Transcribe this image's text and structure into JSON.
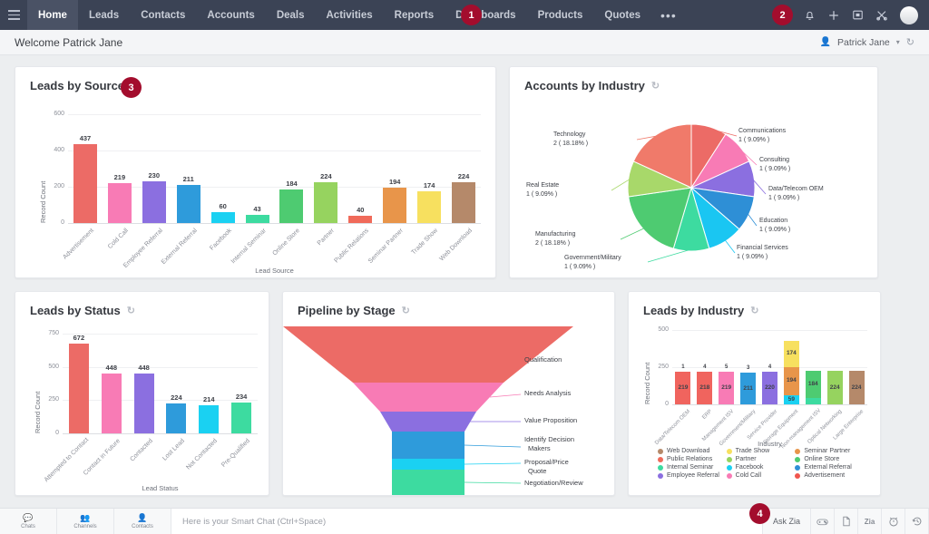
{
  "nav": {
    "menu_icon": "hamburger-icon",
    "tabs": [
      "Home",
      "Leads",
      "Contacts",
      "Accounts",
      "Deals",
      "Activities",
      "Reports",
      "Dashboards",
      "Products",
      "Quotes"
    ],
    "active_tab": "Home",
    "more_label": "•••",
    "badge_1": "1",
    "badge_2": "2",
    "icons": [
      "search-icon",
      "bell-icon",
      "plus-icon",
      "screen-icon",
      "tools-icon",
      "avatar"
    ]
  },
  "welcome": {
    "title": "Welcome Patrick Jane",
    "user": "Patrick Jane",
    "caret": "▾",
    "refresh": "↻"
  },
  "cards": {
    "leads_by_source": {
      "title": "Leads by Source",
      "refresh": "↻",
      "badge": "3"
    },
    "accounts_by_industry": {
      "title": "Accounts by Industry",
      "refresh": "↻"
    },
    "leads_by_status": {
      "title": "Leads by Status",
      "refresh": "↻"
    },
    "pipeline_by_stage": {
      "title": "Pipeline by Stage",
      "refresh": "↻"
    },
    "leads_by_industry": {
      "title": "Leads by Industry",
      "refresh": "↻",
      "badge": "4"
    }
  },
  "chart_data": [
    {
      "id": "leads_by_source",
      "type": "bar",
      "title": "Leads by Source",
      "xlabel": "Lead Source",
      "ylabel": "Record Count",
      "ylim": [
        0,
        600
      ],
      "yticks": [
        0,
        200,
        400,
        600
      ],
      "grid": true,
      "categories": [
        "Advertisement",
        "Cold Call",
        "Employee Referral",
        "External Referral",
        "Facebook",
        "Internal Seminar",
        "Online Store",
        "Partner",
        "Public Relations",
        "Seminar Partner",
        "Trade Show",
        "Web Download"
      ],
      "values": [
        437,
        219,
        230,
        211,
        60,
        43,
        184,
        224,
        40,
        194,
        174,
        224
      ],
      "colors": [
        "#ec6b66",
        "#f87bb5",
        "#8b6fe0",
        "#2e9bdb",
        "#1ad1f2",
        "#3ddba0",
        "#4ecb71",
        "#96d35f",
        "#f06a5a",
        "#e8954a",
        "#f7e05f",
        "#b5896a"
      ]
    },
    {
      "id": "accounts_by_industry",
      "type": "pie",
      "title": "Accounts by Industry",
      "legend_position": "callouts",
      "slices": [
        {
          "label": "Communications",
          "count": 1,
          "percent": "9.09%",
          "color": "#ec6b66"
        },
        {
          "label": "Consulting",
          "count": 1,
          "percent": "9.09%",
          "color": "#f87bb5"
        },
        {
          "label": "Data/Telecom OEM",
          "count": 1,
          "percent": "9.09%",
          "color": "#8b6fe0"
        },
        {
          "label": "Education",
          "count": 1,
          "percent": "9.09%",
          "color": "#2e8fd6"
        },
        {
          "label": "Financial Services",
          "count": 1,
          "percent": "9.09%",
          "color": "#1ac6f2"
        },
        {
          "label": "Government/Military",
          "count": 1,
          "percent": "9.09%",
          "color": "#3ddba0"
        },
        {
          "label": "Manufacturing",
          "count": 2,
          "percent": "18.18%",
          "color": "#4ecb71"
        },
        {
          "label": "Real Estate",
          "count": 1,
          "percent": "9.09%",
          "color": "#a8d86a"
        },
        {
          "label": "Technology",
          "count": 2,
          "percent": "18.18%",
          "color": "#f07a6a"
        }
      ]
    },
    {
      "id": "leads_by_status",
      "type": "bar",
      "title": "Leads by Status",
      "xlabel": "Lead Status",
      "ylabel": "Record Count",
      "ylim": [
        0,
        750
      ],
      "yticks": [
        0,
        250,
        500,
        750
      ],
      "grid": true,
      "categories": [
        "Attempted to Contact",
        "Contact in Future",
        "Contacted",
        "Lost Lead",
        "Not Contacted",
        "Pre-Qualified"
      ],
      "values": [
        672,
        448,
        448,
        224,
        214,
        234
      ],
      "colors": [
        "#ec6b66",
        "#f87bb5",
        "#8b6fe0",
        "#2e9bdb",
        "#1ad1f2",
        "#3ddba0"
      ]
    },
    {
      "id": "pipeline_by_stage",
      "type": "funnel",
      "title": "Pipeline by Stage",
      "stages": [
        {
          "label": "Qualification",
          "color": "#ec6b66"
        },
        {
          "label": "Needs Analysis",
          "color": "#f87bb5"
        },
        {
          "label": "Value Proposition",
          "color": "#8b6fe0"
        },
        {
          "label": "Identify Decision Makers",
          "color": "#2e9bdb"
        },
        {
          "label": "Proposal/Price Quote",
          "color": "#1ad1f2"
        },
        {
          "label": "Negotiation/Review",
          "color": "#3ddba0"
        }
      ]
    },
    {
      "id": "leads_by_industry",
      "type": "bar",
      "stacked": true,
      "title": "Leads by Industry",
      "xlabel": "Industry",
      "ylabel": "Record Count",
      "ylim": [
        0,
        500
      ],
      "yticks": [
        0,
        250,
        500
      ],
      "grid": true,
      "categories": [
        "Data/Telecom OEM",
        "ERP",
        "Management ISV",
        "Government/Military",
        "Service Provider",
        "Storage Equipment",
        "Non-management ISV",
        "Optical Networking",
        "Large Enterprise"
      ],
      "bars": [
        {
          "segments": [
            {
              "value": 219,
              "color": "#f0645e"
            }
          ],
          "top_label": "1"
        },
        {
          "segments": [
            {
              "value": 218,
              "color": "#f0645e"
            }
          ],
          "top_label": "4"
        },
        {
          "segments": [
            {
              "value": 219,
              "color": "#f87bb5"
            }
          ],
          "top_label": "5"
        },
        {
          "segments": [
            {
              "value": 211,
              "color": "#2e9bdb"
            }
          ],
          "top_label": "3"
        },
        {
          "segments": [
            {
              "value": 220,
              "color": "#8b6fe0"
            }
          ],
          "top_label": "4"
        },
        {
          "segments": [
            {
              "value": 59,
              "color": "#1ad1f2"
            },
            {
              "value": 194,
              "color": "#e8954a"
            },
            {
              "value": 174,
              "color": "#f7e05f"
            }
          ],
          "top_label": ""
        },
        {
          "segments": [
            {
              "value": 40,
              "color": "#3ddba0"
            },
            {
              "value": 184,
              "color": "#4ecb71"
            }
          ],
          "top_label": ""
        },
        {
          "segments": [
            {
              "value": 224,
              "color": "#96d35f"
            }
          ],
          "top_label": ""
        },
        {
          "segments": [
            {
              "value": 224,
              "color": "#b5896a"
            }
          ],
          "top_label": ""
        }
      ],
      "legend": [
        {
          "label": "Web Download",
          "color": "#b5896a"
        },
        {
          "label": "Trade Show",
          "color": "#f7e05f"
        },
        {
          "label": "Seminar Partner",
          "color": "#e8954a"
        },
        {
          "label": "Public Relations",
          "color": "#f06a5a"
        },
        {
          "label": "Partner",
          "color": "#96d35f"
        },
        {
          "label": "Online Store",
          "color": "#4ecb71"
        },
        {
          "label": "Internal Seminar",
          "color": "#3ddba0"
        },
        {
          "label": "Facebook",
          "color": "#1ad1f2"
        },
        {
          "label": "External Referral",
          "color": "#2e8fd6"
        },
        {
          "label": "Employee Referral",
          "color": "#8b6fe0"
        },
        {
          "label": "Cold Call",
          "color": "#f87bb5"
        },
        {
          "label": "Advertisement",
          "color": "#f0564e"
        }
      ]
    }
  ],
  "bottombar": {
    "chat_items": [
      {
        "label": "Chats",
        "icon": "chat-icon"
      },
      {
        "label": "Channels",
        "icon": "channels-icon"
      },
      {
        "label": "Contacts",
        "icon": "contacts-icon"
      }
    ],
    "chat_placeholder": "Here is your Smart Chat (Ctrl+Space)",
    "ask_zia": "Ask Zia",
    "icons": [
      "game-controller-icon",
      "document-icon",
      "zia-icon",
      "alarm-icon",
      "history-icon"
    ],
    "badge": "4"
  }
}
